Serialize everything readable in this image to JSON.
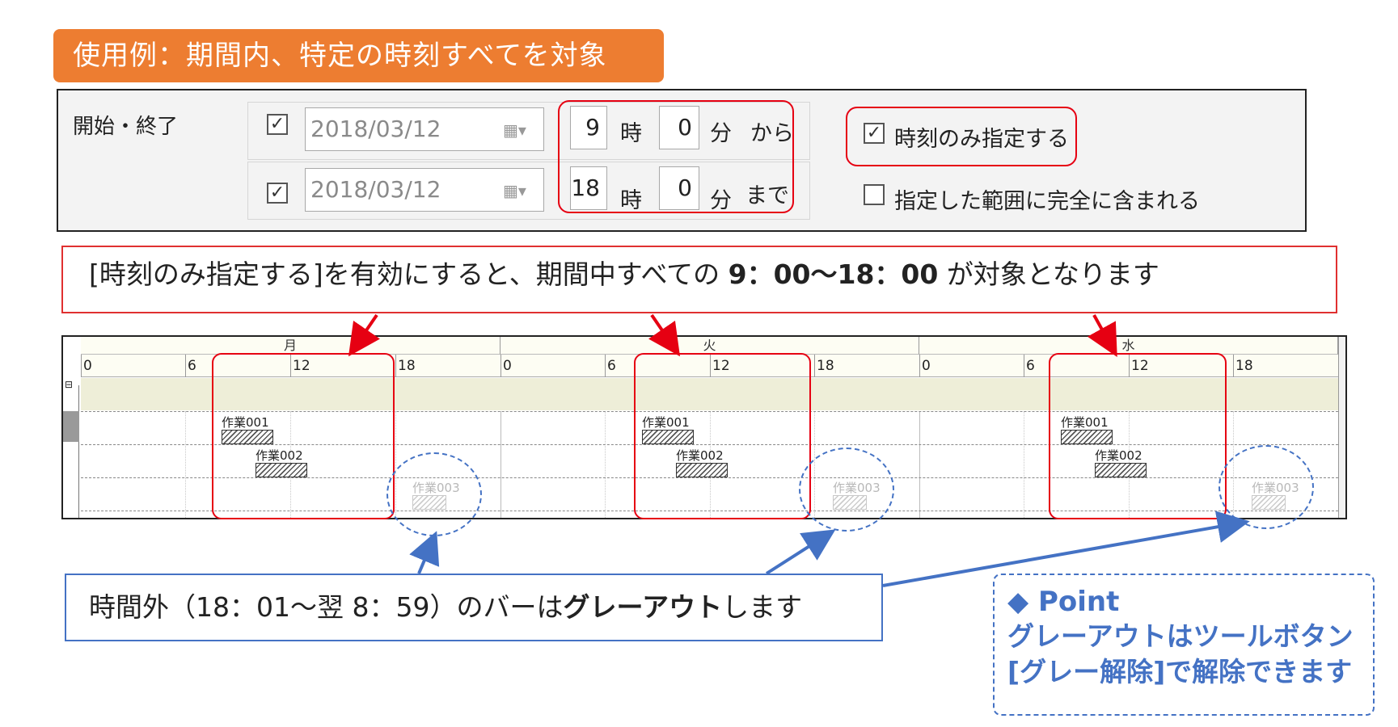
{
  "banner": {
    "title": "使用例：期間内、特定の時刻すべてを対象"
  },
  "period": {
    "label": "開始・終了",
    "start": {
      "checked": true,
      "date": "2018/03/12",
      "hour": "9",
      "hour_unit": "時",
      "minute": "0",
      "minute_unit": "分",
      "suffix": "から"
    },
    "end": {
      "checked": true,
      "date": "2018/03/12",
      "hour": "18",
      "hour_unit": "時",
      "minute": "0",
      "minute_unit": "分",
      "suffix": "まで"
    },
    "options": [
      {
        "label": "時刻のみ指定する",
        "checked": true
      },
      {
        "label": "指定した範囲に完全に含まれる",
        "checked": false
      }
    ]
  },
  "note_top": {
    "before": "[時刻のみ指定する]を有効にすると、期間中すべての ",
    "emph": "9：00～18：00",
    "after": " が対象となります"
  },
  "gantt": {
    "collapse_icon": "⊟",
    "days": [
      {
        "label": "月",
        "ticks": [
          "0",
          "6",
          "12",
          "18"
        ]
      },
      {
        "label": "火",
        "ticks": [
          "0",
          "6",
          "12",
          "18"
        ]
      },
      {
        "label": "水",
        "ticks": [
          "0",
          "6",
          "12",
          "18"
        ]
      }
    ],
    "tasks": [
      {
        "label": "作業001",
        "greyed": false
      },
      {
        "label": "作業002",
        "greyed": false
      },
      {
        "label": "作業003",
        "greyed": true
      }
    ]
  },
  "note_bottom": {
    "before": "時間外（18：01～翌 8：59）のバーは",
    "emph": "グレーアウト",
    "after": "します"
  },
  "point": {
    "title": "◆ Point",
    "line1": "グレーアウトはツールボタン",
    "line2": "[グレー解除]で解除できます"
  },
  "colors": {
    "accent_orange": "#ed7d31",
    "highlight_red": "#e60012",
    "point_blue": "#4472c4"
  }
}
